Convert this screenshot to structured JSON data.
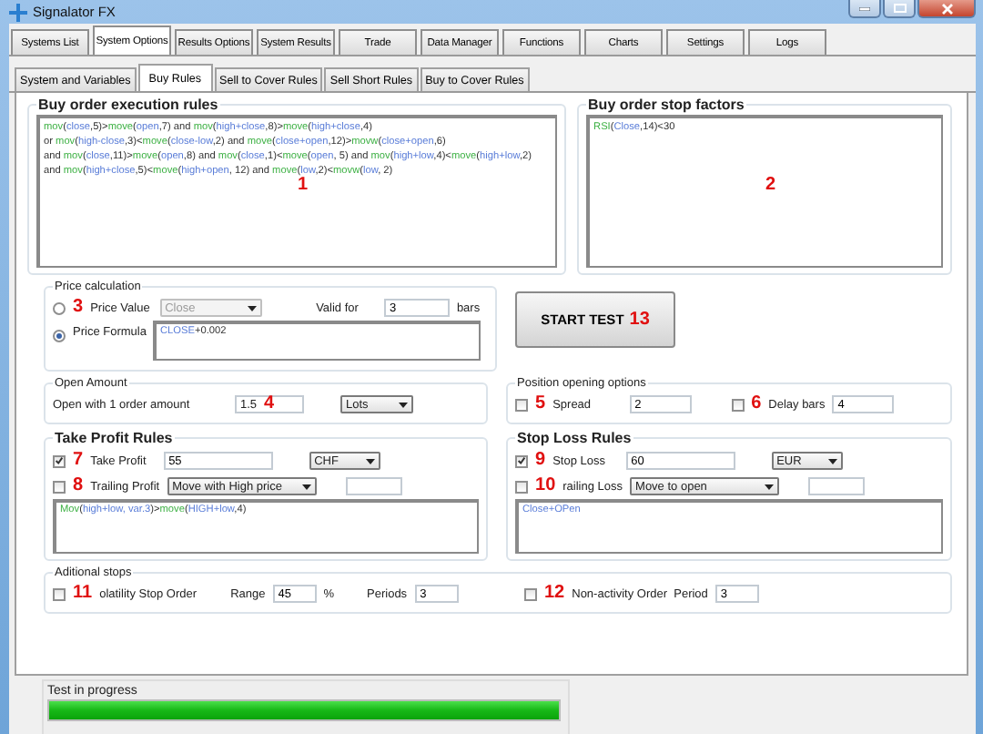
{
  "window": {
    "title": "Signalator FX"
  },
  "tabs": [
    {
      "label": "Systems List",
      "selected": false
    },
    {
      "label": "System Options",
      "selected": true
    },
    {
      "label": "Results Options",
      "selected": false
    },
    {
      "label": "System Results",
      "selected": false
    },
    {
      "label": "Trade",
      "selected": false
    },
    {
      "label": "Data Manager",
      "selected": false
    },
    {
      "label": "Functions",
      "selected": false
    },
    {
      "label": "Charts",
      "selected": false
    },
    {
      "label": "Settings",
      "selected": false
    },
    {
      "label": "Logs",
      "selected": false
    }
  ],
  "subtabs": [
    {
      "label": "System and Variables",
      "selected": false
    },
    {
      "label": "Buy Rules",
      "selected": true
    },
    {
      "label": "Sell to Cover Rules",
      "selected": false
    },
    {
      "label": "Sell Short Rules",
      "selected": false
    },
    {
      "label": "Buy to Cover Rules",
      "selected": false
    }
  ],
  "execution_rules": {
    "title": "Buy order execution rules",
    "marker": "1",
    "lines": [
      [
        {
          "text": "mov",
          "kind": "function"
        },
        {
          "text": "(",
          "kind": "plain"
        },
        {
          "text": "close",
          "kind": "argument"
        },
        {
          "text": ",5)>",
          "kind": "plain"
        },
        {
          "text": "move",
          "kind": "function"
        },
        {
          "text": "(",
          "kind": "plain"
        },
        {
          "text": "open",
          "kind": "argument"
        },
        {
          "text": ",7) and ",
          "kind": "plain"
        },
        {
          "text": "mov",
          "kind": "function"
        },
        {
          "text": "(",
          "kind": "plain"
        },
        {
          "text": "high+close",
          "kind": "argument"
        },
        {
          "text": ",8)>",
          "kind": "plain"
        },
        {
          "text": "move",
          "kind": "function"
        },
        {
          "text": "(",
          "kind": "plain"
        },
        {
          "text": "high+close",
          "kind": "argument"
        },
        {
          "text": ",4)",
          "kind": "plain"
        }
      ],
      [
        {
          "text": "or ",
          "kind": "plain"
        },
        {
          "text": "mov",
          "kind": "function"
        },
        {
          "text": "(",
          "kind": "plain"
        },
        {
          "text": "high-close",
          "kind": "argument"
        },
        {
          "text": ",3)<",
          "kind": "plain"
        },
        {
          "text": "move",
          "kind": "function"
        },
        {
          "text": "(",
          "kind": "plain"
        },
        {
          "text": "close-low",
          "kind": "argument"
        },
        {
          "text": ",2) and ",
          "kind": "plain"
        },
        {
          "text": "move",
          "kind": "function"
        },
        {
          "text": "(",
          "kind": "plain"
        },
        {
          "text": "close+open",
          "kind": "argument"
        },
        {
          "text": ",12)>",
          "kind": "plain"
        },
        {
          "text": "movw",
          "kind": "function"
        },
        {
          "text": "(",
          "kind": "plain"
        },
        {
          "text": "close+open",
          "kind": "argument"
        },
        {
          "text": ",6)",
          "kind": "plain"
        }
      ],
      [
        {
          "text": "and ",
          "kind": "plain"
        },
        {
          "text": "mov",
          "kind": "function"
        },
        {
          "text": "(",
          "kind": "plain"
        },
        {
          "text": "close",
          "kind": "argument"
        },
        {
          "text": ",11)>",
          "kind": "plain"
        },
        {
          "text": "move",
          "kind": "function"
        },
        {
          "text": "(",
          "kind": "plain"
        },
        {
          "text": "open",
          "kind": "argument"
        },
        {
          "text": ",8) and ",
          "kind": "plain"
        },
        {
          "text": "mov",
          "kind": "function"
        },
        {
          "text": "(",
          "kind": "plain"
        },
        {
          "text": "close",
          "kind": "argument"
        },
        {
          "text": ",1)<",
          "kind": "plain"
        },
        {
          "text": "move",
          "kind": "function"
        },
        {
          "text": "(",
          "kind": "plain"
        },
        {
          "text": "open",
          "kind": "argument"
        },
        {
          "text": ", 5) and ",
          "kind": "plain"
        },
        {
          "text": "mov",
          "kind": "function"
        },
        {
          "text": "(",
          "kind": "plain"
        },
        {
          "text": "high+low",
          "kind": "argument"
        },
        {
          "text": ",4)<",
          "kind": "plain"
        },
        {
          "text": "move",
          "kind": "function"
        },
        {
          "text": "(",
          "kind": "plain"
        },
        {
          "text": "high+low",
          "kind": "argument"
        },
        {
          "text": ",2)",
          "kind": "plain"
        }
      ],
      [
        {
          "text": "and ",
          "kind": "plain"
        },
        {
          "text": "mov",
          "kind": "function"
        },
        {
          "text": "(",
          "kind": "plain"
        },
        {
          "text": "high+close",
          "kind": "argument"
        },
        {
          "text": ",5)<",
          "kind": "plain"
        },
        {
          "text": "move",
          "kind": "function"
        },
        {
          "text": "(",
          "kind": "plain"
        },
        {
          "text": "high+open",
          "kind": "argument"
        },
        {
          "text": ", 12) and ",
          "kind": "plain"
        },
        {
          "text": "move",
          "kind": "function"
        },
        {
          "text": "(",
          "kind": "plain"
        },
        {
          "text": "low",
          "kind": "argument"
        },
        {
          "text": ",2)<",
          "kind": "plain"
        },
        {
          "text": "movw",
          "kind": "function"
        },
        {
          "text": "(",
          "kind": "plain"
        },
        {
          "text": "low",
          "kind": "argument"
        },
        {
          "text": ", 2)",
          "kind": "plain"
        }
      ]
    ]
  },
  "stop_factors": {
    "title": "Buy order stop factors",
    "marker": "2",
    "lines": [
      [
        {
          "text": "RSI",
          "kind": "function"
        },
        {
          "text": "(",
          "kind": "plain"
        },
        {
          "text": "Close",
          "kind": "argument"
        },
        {
          "text": ",14)<30",
          "kind": "plain"
        }
      ]
    ]
  },
  "price_calculation": {
    "title": "Price calculation",
    "price_value": {
      "label": "Price Value",
      "marker": "3",
      "selected": false,
      "value": "Close",
      "disabled": true
    },
    "valid_for": {
      "label": "Valid for",
      "value": "3",
      "unit": "bars"
    },
    "price_formula": {
      "label": "Price Formula",
      "selected": true,
      "formula": [
        {
          "text": "CLOSE",
          "kind": "argument"
        },
        {
          "text": "+0.002",
          "kind": "plain"
        }
      ]
    }
  },
  "start_button": {
    "label": "START TEST",
    "marker": "13"
  },
  "open_amount": {
    "title": "Open Amount",
    "label": "Open with 1 order amount",
    "value": "1.5",
    "marker": "4",
    "unit": "Lots"
  },
  "position_options": {
    "title": "Position opening options",
    "items": [
      {
        "label": "Spread",
        "marker": "5",
        "checked": false,
        "value": "2"
      },
      {
        "label": "Delay bars",
        "marker": "6",
        "checked": false,
        "value": "4"
      }
    ]
  },
  "take_profit": {
    "title": "Take Profit Rules",
    "main": {
      "label": "Take Profit",
      "marker": "7",
      "checked": true,
      "value": "55",
      "currency": "CHF"
    },
    "trailing": {
      "label": "Trailing Profit",
      "marker": "8",
      "checked": false,
      "mode": "Move with High price"
    },
    "formula": [
      {
        "text": "Mov",
        "kind": "function"
      },
      {
        "text": "(",
        "kind": "plain"
      },
      {
        "text": "high+low, var.3",
        "kind": "argument"
      },
      {
        "text": ")>",
        "kind": "plain"
      },
      {
        "text": "move",
        "kind": "function"
      },
      {
        "text": "(",
        "kind": "plain"
      },
      {
        "text": "HIGH+low",
        "kind": "argument"
      },
      {
        "text": ",4)",
        "kind": "plain"
      }
    ]
  },
  "stop_loss": {
    "title": "Stop Loss Rules",
    "main": {
      "label": "Stop Loss",
      "marker": "9",
      "checked": true,
      "value": "60",
      "currency": "EUR"
    },
    "trailing": {
      "label": "railing Loss",
      "marker": "10",
      "checked": false,
      "mode": "Move to open"
    },
    "formula": [
      {
        "text": "Close+OPen",
        "kind": "argument"
      }
    ]
  },
  "additional_stops": {
    "title": "Aditional stops",
    "items": [
      {
        "marker": "11",
        "label": "olatility Stop Order",
        "checked": false,
        "fields": [
          {
            "label": "Range",
            "value": "45",
            "unit": "%"
          },
          {
            "label": "Periods",
            "value": "3"
          }
        ]
      },
      {
        "marker": "12",
        "label": "Non-activity Order",
        "checked": false,
        "fields": [
          {
            "label": "Period",
            "value": "3"
          }
        ]
      }
    ]
  },
  "status": {
    "label": "Test in progress",
    "level": 1
  }
}
